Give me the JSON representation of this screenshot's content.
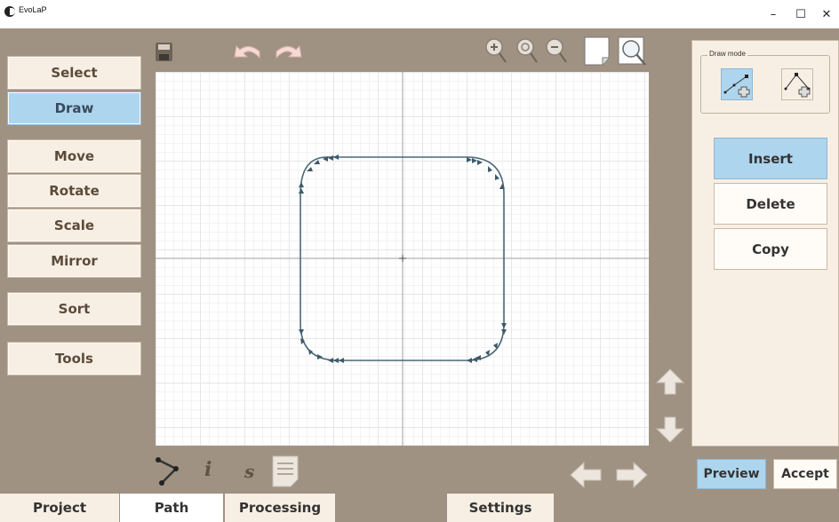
{
  "window": {
    "title": "EvoLaP",
    "minimize": "–",
    "maximize": "☐",
    "close": "✕"
  },
  "left_menu": {
    "select": "Select",
    "draw": "Draw",
    "move": "Move",
    "rotate": "Rotate",
    "scale": "Scale",
    "mirror": "Mirror",
    "sort": "Sort",
    "tools": "Tools"
  },
  "canvas_toolbar": {
    "icons": [
      "save-icon",
      "undo-icon",
      "redo-icon",
      "zoom-in-icon",
      "zoom-reset-icon",
      "zoom-out-icon",
      "page-icon",
      "zoom-fit-icon"
    ]
  },
  "right_panel": {
    "draw_mode_label": "Draw mode",
    "insert": "Insert",
    "delete": "Delete",
    "copy": "Copy"
  },
  "bottom_toolbar": {
    "info_label": "i",
    "s_label": "s"
  },
  "footer": {
    "preview": "Preview",
    "accept": "Accept"
  },
  "tabs": [
    {
      "label": "Project"
    },
    {
      "label": "Path"
    },
    {
      "label": "Processing"
    },
    {
      "label": "Settings"
    }
  ],
  "colors": {
    "accent": "#aed5ee",
    "panel": "#f8efe4",
    "background": "#a09282",
    "path": "#4a6878"
  }
}
